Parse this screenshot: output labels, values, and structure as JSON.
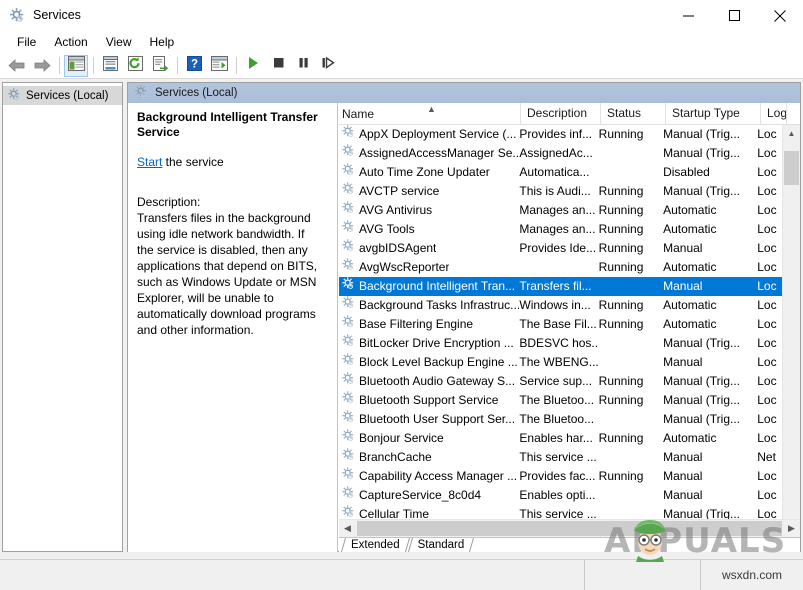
{
  "window": {
    "title": "Services",
    "app_icon": "services-gear-icon",
    "controls": {
      "minimize": "minimize-icon",
      "maximize": "maximize-icon",
      "close": "close-icon"
    }
  },
  "menu": {
    "items": [
      {
        "label": "File"
      },
      {
        "label": "Action"
      },
      {
        "label": "View"
      },
      {
        "label": "Help"
      }
    ]
  },
  "toolbar": {
    "buttons": [
      {
        "name": "back-button",
        "icon": "left-arrow-icon"
      },
      {
        "name": "forward-button",
        "icon": "right-arrow-icon"
      },
      {
        "name": "show-hide-console-tree-button",
        "icon": "tree-pane-icon",
        "active": true
      },
      {
        "name": "properties-button",
        "icon": "properties-icon"
      },
      {
        "name": "refresh-button",
        "icon": "refresh-icon"
      },
      {
        "name": "export-list-button",
        "icon": "export-icon"
      },
      {
        "name": "help-button",
        "icon": "help-icon"
      },
      {
        "name": "show-hide-action-pane-button",
        "icon": "action-pane-icon"
      },
      {
        "name": "start-service-button",
        "icon": "play-icon"
      },
      {
        "name": "stop-service-button",
        "icon": "stop-icon"
      },
      {
        "name": "pause-service-button",
        "icon": "pause-icon"
      },
      {
        "name": "restart-service-button",
        "icon": "restart-icon"
      }
    ]
  },
  "tree": {
    "items": [
      {
        "label": "Services (Local)",
        "icon": "services-gear-icon",
        "selected": true
      }
    ]
  },
  "right_pane": {
    "header": {
      "label": "Services (Local)",
      "icon": "services-gear-icon"
    }
  },
  "detail": {
    "service_name": "Background Intelligent Transfer Service",
    "action_link": "Start",
    "action_suffix": " the service",
    "description_label": "Description:",
    "description": "Transfers files in the background using idle network bandwidth. If the service is disabled, then any applications that depend on BITS, such as Windows Update or MSN Explorer, will be unable to automatically download programs and other information."
  },
  "list": {
    "columns": [
      {
        "key": "name",
        "label": "Name",
        "sorted": "asc",
        "sort_icon": "chevron-up-icon"
      },
      {
        "key": "description",
        "label": "Description"
      },
      {
        "key": "status",
        "label": "Status"
      },
      {
        "key": "startup",
        "label": "Startup Type"
      },
      {
        "key": "logon",
        "label": "Log"
      }
    ],
    "rows": [
      {
        "name": "AppX Deployment Service (...",
        "description": "Provides inf...",
        "status": "Running",
        "startup": "Manual (Trig...",
        "logon": "Loc",
        "selected": false
      },
      {
        "name": "AssignedAccessManager Se...",
        "description": "AssignedAc...",
        "status": "",
        "startup": "Manual (Trig...",
        "logon": "Loc",
        "selected": false
      },
      {
        "name": "Auto Time Zone Updater",
        "description": "Automatica...",
        "status": "",
        "startup": "Disabled",
        "logon": "Loc",
        "selected": false
      },
      {
        "name": "AVCTP service",
        "description": "This is Audi...",
        "status": "Running",
        "startup": "Manual (Trig...",
        "logon": "Loc",
        "selected": false
      },
      {
        "name": "AVG Antivirus",
        "description": "Manages an...",
        "status": "Running",
        "startup": "Automatic",
        "logon": "Loc",
        "selected": false
      },
      {
        "name": "AVG Tools",
        "description": "Manages an...",
        "status": "Running",
        "startup": "Automatic",
        "logon": "Loc",
        "selected": false
      },
      {
        "name": "avgbIDSAgent",
        "description": "Provides Ide...",
        "status": "Running",
        "startup": "Manual",
        "logon": "Loc",
        "selected": false
      },
      {
        "name": "AvgWscReporter",
        "description": "",
        "status": "Running",
        "startup": "Automatic",
        "logon": "Loc",
        "selected": false
      },
      {
        "name": "Background Intelligent Tran...",
        "description": "Transfers fil...",
        "status": "",
        "startup": "Manual",
        "logon": "Loc",
        "selected": true
      },
      {
        "name": "Background Tasks Infrastruc...",
        "description": "Windows in...",
        "status": "Running",
        "startup": "Automatic",
        "logon": "Loc",
        "selected": false
      },
      {
        "name": "Base Filtering Engine",
        "description": "The Base Fil...",
        "status": "Running",
        "startup": "Automatic",
        "logon": "Loc",
        "selected": false
      },
      {
        "name": "BitLocker Drive Encryption ...",
        "description": "BDESVC hos...",
        "status": "",
        "startup": "Manual (Trig...",
        "logon": "Loc",
        "selected": false
      },
      {
        "name": "Block Level Backup Engine ...",
        "description": "The WBENG...",
        "status": "",
        "startup": "Manual",
        "logon": "Loc",
        "selected": false
      },
      {
        "name": "Bluetooth Audio Gateway S...",
        "description": "Service sup...",
        "status": "Running",
        "startup": "Manual (Trig...",
        "logon": "Loc",
        "selected": false
      },
      {
        "name": "Bluetooth Support Service",
        "description": "The Bluetoo...",
        "status": "Running",
        "startup": "Manual (Trig...",
        "logon": "Loc",
        "selected": false
      },
      {
        "name": "Bluetooth User Support Ser...",
        "description": "The Bluetoo...",
        "status": "",
        "startup": "Manual (Trig...",
        "logon": "Loc",
        "selected": false
      },
      {
        "name": "Bonjour Service",
        "description": "Enables har...",
        "status": "Running",
        "startup": "Automatic",
        "logon": "Loc",
        "selected": false
      },
      {
        "name": "BranchCache",
        "description": "This service ...",
        "status": "",
        "startup": "Manual",
        "logon": "Net",
        "selected": false
      },
      {
        "name": "Capability Access Manager ...",
        "description": "Provides fac...",
        "status": "Running",
        "startup": "Manual",
        "logon": "Loc",
        "selected": false
      },
      {
        "name": "CaptureService_8c0d4",
        "description": "Enables opti...",
        "status": "",
        "startup": "Manual",
        "logon": "Loc",
        "selected": false
      },
      {
        "name": "Cellular Time",
        "description": "This service ...",
        "status": "",
        "startup": "Manual (Trig...",
        "logon": "Loc",
        "selected": false
      }
    ],
    "scrollbars": {
      "vertical": {
        "up_icon": "chevron-up-icon",
        "down_icon": "chevron-down-icon"
      },
      "horizontal": {
        "left_icon": "chevron-left-icon",
        "right_icon": "chevron-right-icon"
      }
    }
  },
  "tabs": {
    "items": [
      {
        "label": "Extended",
        "active": false
      },
      {
        "label": "Standard",
        "active": true
      }
    ]
  },
  "statusbar": {
    "right_text": "wsxdn.com"
  },
  "watermark": {
    "text": "APPUALS"
  },
  "colors": {
    "selection": "#0078d7",
    "link": "#0563c1",
    "pane_header_top": "#b2c5dd",
    "play_green": "#3fa12b",
    "help_blue": "#1b5fbd"
  }
}
